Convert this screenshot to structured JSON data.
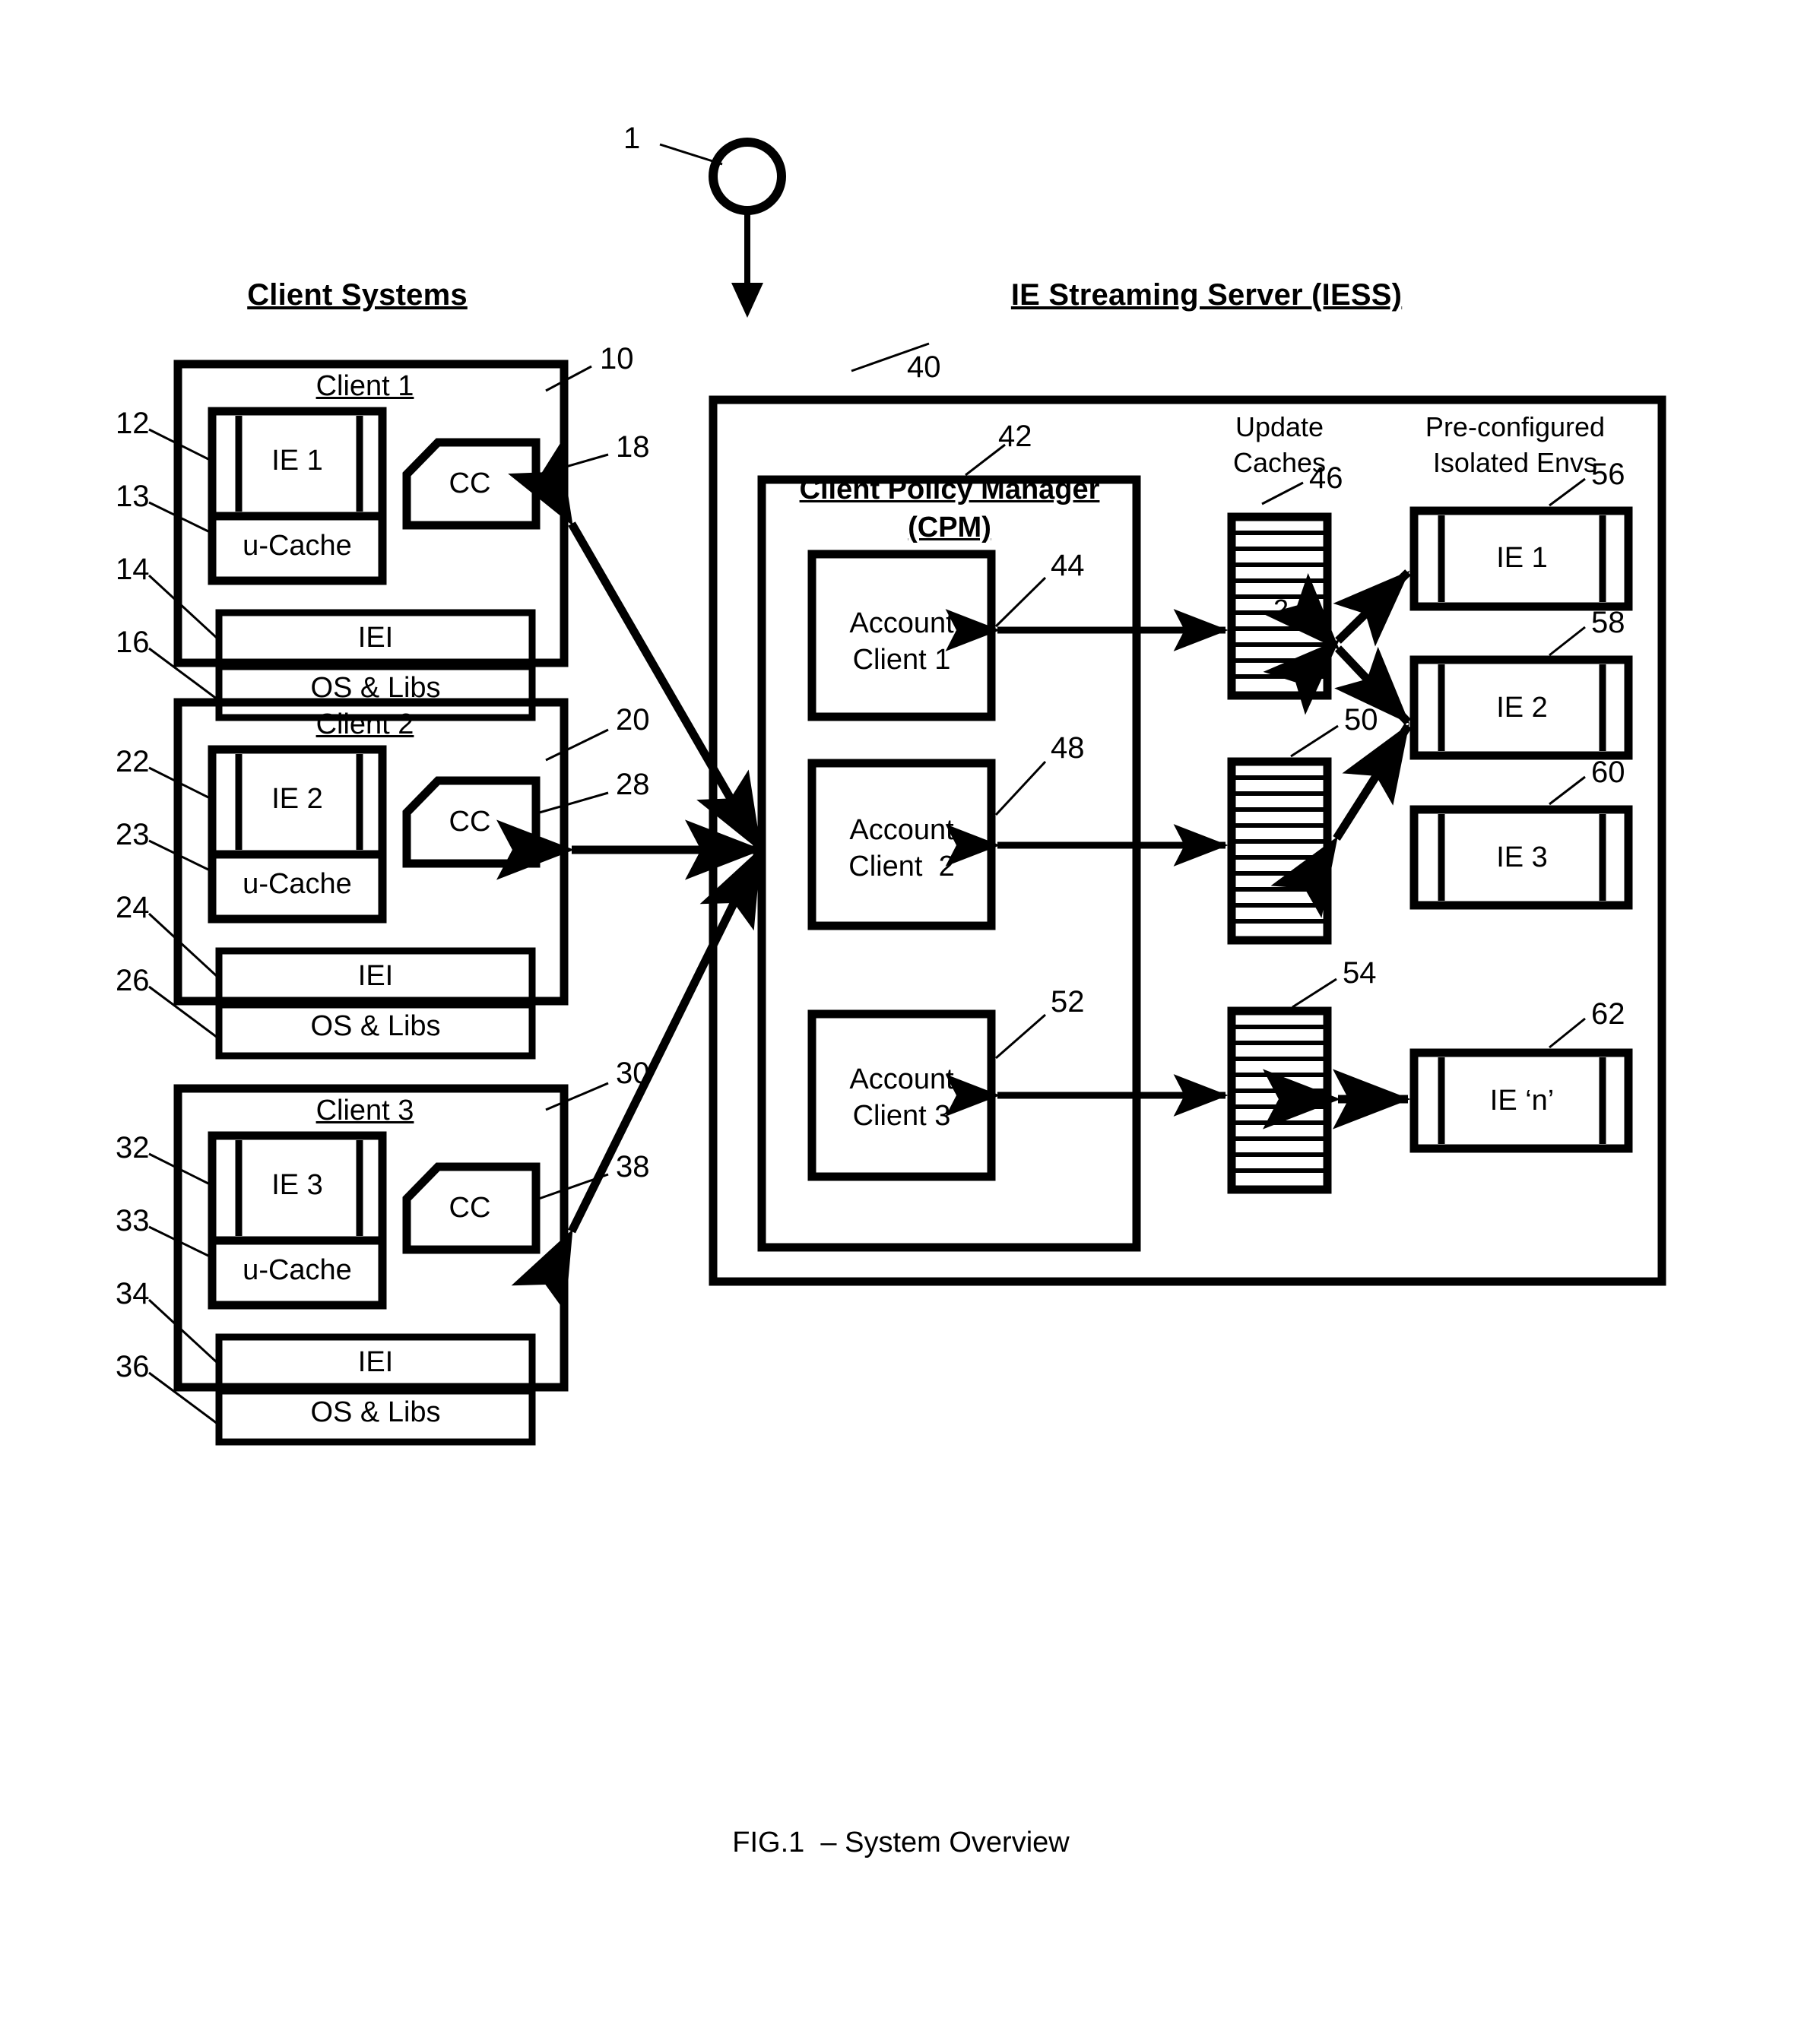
{
  "figure": {
    "caption": "FIG.1  – System Overview",
    "system_ref": "1"
  },
  "headings": {
    "client_systems": "Client Systems",
    "iess": "IE Streaming Server (IESS)",
    "update_caches": "Update\nCaches",
    "preconfigured_envs": "Pre-configured\nIsolated Envs"
  },
  "clients": [
    {
      "title": "Client 1",
      "box_ref": "10",
      "ie_label": "IE 1",
      "ie_ref": "12",
      "ucache_label": "u-Cache",
      "ucache_ref": "13",
      "iei_label": "IEI",
      "iei_ref": "14",
      "os_label": "OS & Libs",
      "os_ref": "16",
      "cc_label": "CC",
      "cc_ref": "18"
    },
    {
      "title": "Client 2",
      "box_ref": "20",
      "ie_label": "IE 2",
      "ie_ref": "22",
      "ucache_label": "u-Cache",
      "ucache_ref": "23",
      "iei_label": "IEI",
      "iei_ref": "24",
      "os_label": "OS & Libs",
      "os_ref": "26",
      "cc_label": "CC",
      "cc_ref": "28"
    },
    {
      "title": "Client 3",
      "box_ref": "30",
      "ie_label": "IE 3",
      "ie_ref": "32",
      "ucache_label": "u-Cache",
      "ucache_ref": "33",
      "iei_label": "IEI",
      "iei_ref": "34",
      "os_label": "OS & Libs",
      "os_ref": "36",
      "cc_label": "CC",
      "cc_ref": "38"
    }
  ],
  "server": {
    "box_ref": "40",
    "cpm": {
      "title_line1": "Client Policy Manager",
      "title_line2": "(CPM)",
      "ref": "42",
      "accounts": [
        {
          "line1": "Account",
          "line2": "Client 1",
          "ref": "44"
        },
        {
          "line1": "Account",
          "line2": "Client  2",
          "ref": "48"
        },
        {
          "line1": "Account",
          "line2": "Client 3",
          "ref": "52"
        }
      ]
    },
    "update_caches": [
      {
        "ref": "46",
        "inner_label": "2",
        "stripes": 11
      },
      {
        "ref": "50",
        "inner_label": "",
        "stripes": 11
      },
      {
        "ref": "54",
        "inner_label": "",
        "stripes": 11
      }
    ],
    "isolated_envs": [
      {
        "label": "IE 1",
        "ref": "56"
      },
      {
        "label": "IE 2",
        "ref": "58"
      },
      {
        "label": "IE 3",
        "ref": "60"
      },
      {
        "label": "IE ‘n’",
        "ref": "62"
      }
    ]
  },
  "colors": {
    "ink": "#000000",
    "paper": "#ffffff"
  }
}
